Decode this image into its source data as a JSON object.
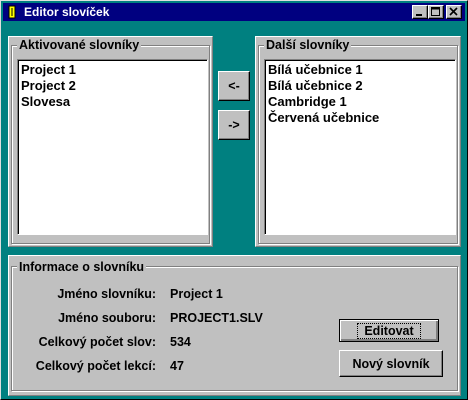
{
  "window": {
    "title": "Editor slovíček"
  },
  "active_group": {
    "title": "Aktivované slovníky",
    "items": [
      "Project 1",
      "Project 2",
      "Slovesa"
    ]
  },
  "other_group": {
    "title": "Další slovníky",
    "items": [
      "Bílá učebnice 1",
      "Bílá učebnice 2",
      "Cambridge 1",
      "Červená učebnice"
    ]
  },
  "move_buttons": {
    "left_label": "<-",
    "right_label": "->"
  },
  "info": {
    "title": "Informace o slovníku",
    "name_label": "Jméno slovníku:",
    "name_value": "Project 1",
    "file_label": "Jméno souboru:",
    "file_value": "PROJECT1.SLV",
    "words_label": "Celkový počet slov:",
    "words_value": "534",
    "lessons_label": "Celkový počet lekcí:",
    "lessons_value": "47"
  },
  "actions": {
    "edit_label": "Editovat",
    "new_label": "Nový slovník"
  },
  "icons": [
    "app-icon",
    "minimize-icon",
    "maximize-icon",
    "close-icon"
  ],
  "colors": {
    "titlebar": "#000080",
    "desktop": "#008080",
    "face": "#c0c0c0"
  }
}
